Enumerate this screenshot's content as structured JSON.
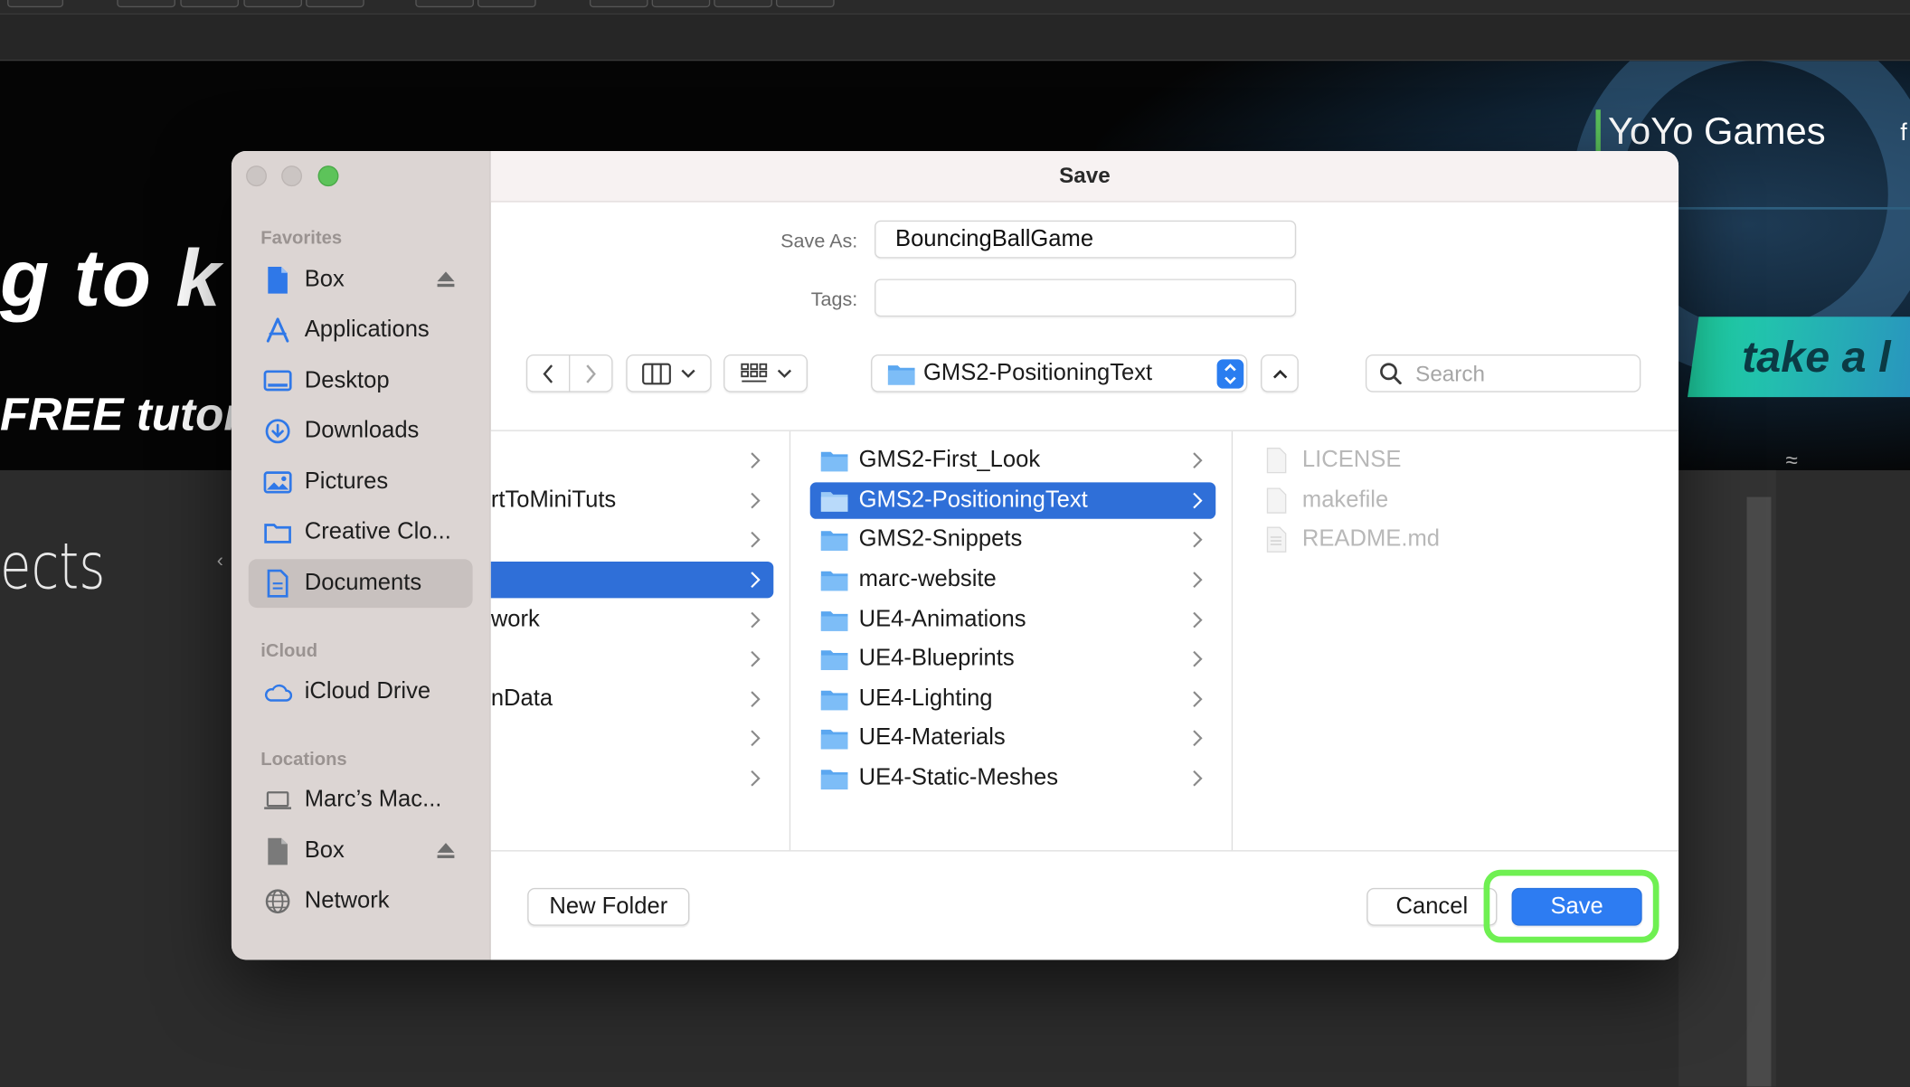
{
  "background": {
    "headline": "g to k",
    "subline": "FREE tutor",
    "brand": "YoYo Games",
    "brand_social": "f",
    "promo": "take a l",
    "section_title": "ects"
  },
  "dialog": {
    "title": "Save",
    "save_as_label": "Save As:",
    "save_as_value": "BouncingBallGame",
    "tags_label": "Tags:",
    "tags_value": "",
    "path_folder": "GMS2-PositioningText",
    "search_placeholder": "Search",
    "new_folder_label": "New Folder",
    "cancel_label": "Cancel",
    "save_label": "Save"
  },
  "sidebar": {
    "sections": [
      {
        "title": "Favorites",
        "items": [
          {
            "label": "Box",
            "icon": "doc-icon",
            "eject": true
          },
          {
            "label": "Applications",
            "icon": "applications-icon"
          },
          {
            "label": "Desktop",
            "icon": "desktop-icon"
          },
          {
            "label": "Downloads",
            "icon": "downloads-icon"
          },
          {
            "label": "Pictures",
            "icon": "pictures-icon"
          },
          {
            "label": "Creative Clo...",
            "icon": "folder-icon"
          },
          {
            "label": "Documents",
            "icon": "documents-icon",
            "selected": true
          }
        ]
      },
      {
        "title": "iCloud",
        "items": [
          {
            "label": "iCloud Drive",
            "icon": "cloud-icon"
          }
        ]
      },
      {
        "title": "Locations",
        "items": [
          {
            "label": "Marc’s Mac...",
            "icon": "laptop-icon"
          },
          {
            "label": "Box",
            "icon": "doc-icon",
            "eject": true
          },
          {
            "label": "Network",
            "icon": "globe-icon"
          }
        ]
      }
    ]
  },
  "columns": {
    "col1": [
      "",
      "rtToMiniTuts",
      "",
      "",
      "work",
      "",
      "nData",
      "",
      ""
    ],
    "col2": [
      "GMS2-First_Look",
      "GMS2-PositioningText",
      "GMS2-Snippets",
      "marc-website",
      "UE4-Animations",
      "UE4-Blueprints",
      "UE4-Lighting",
      "UE4-Materials",
      "UE4-Static-Meshes"
    ],
    "col3": [
      "LICENSE",
      "makefile",
      "README.md"
    ]
  },
  "colors": {
    "accent": "#2d7cf2",
    "selection": "#2f6fd8",
    "highlight": "#6ff052"
  }
}
